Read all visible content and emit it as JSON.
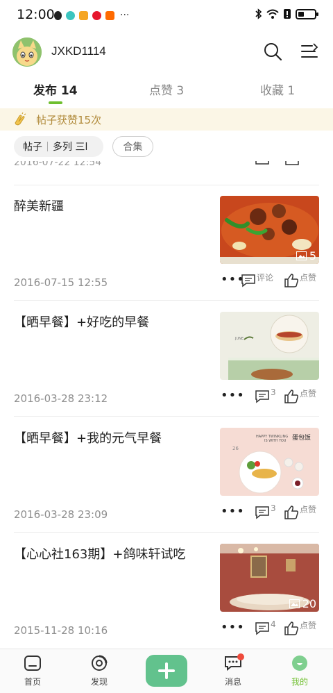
{
  "status_bar": {
    "time": "12:00",
    "more": "···"
  },
  "header": {
    "username": "JXKD1114"
  },
  "tabs": [
    {
      "label": "发布 14"
    },
    {
      "label": "点赞 3"
    },
    {
      "label": "收藏 1"
    }
  ],
  "likes_banner": {
    "text": "帖子获赞15次"
  },
  "filters": {
    "posts_label": "帖子",
    "series_label": "多列 三l",
    "collection_label": "合集"
  },
  "partial_post": {
    "date": "2016-07-22 12:54"
  },
  "posts": [
    {
      "title": "醉美新疆",
      "date": "2016-07-15 12:55",
      "image_count": "5",
      "comment_label": "评论",
      "like_label": "点赞",
      "comment_count": ""
    },
    {
      "title": "【晒早餐】+好吃的早餐",
      "date": "2016-03-28 23:12",
      "image_count": "",
      "comment_label": "",
      "like_label": "点赞",
      "comment_count": "3"
    },
    {
      "title": "【晒早餐】+我的元气早餐",
      "date": "2016-03-28 23:09",
      "image_count": "",
      "comment_label": "",
      "like_label": "点赞",
      "comment_count": "3"
    },
    {
      "title": "【心心社163期】+鸽味轩试吃",
      "date": "2015-11-28 10:16",
      "image_count": "20",
      "comment_label": "",
      "like_label": "点赞",
      "comment_count": "4"
    }
  ],
  "thumb_texts": {
    "b1": "JUNE",
    "b2_line1": "HAPPY TWINKLING",
    "b2_line2": "IS WITH YOU",
    "b2_brand": "蛋包饭",
    "b2_num": "26"
  },
  "bottom_nav": [
    {
      "label": "首页"
    },
    {
      "label": "发现"
    },
    {
      "label": ""
    },
    {
      "label": "消息"
    },
    {
      "label": "我的"
    }
  ],
  "colors": {
    "accent": "#6fbf2f",
    "fab": "#62c28d",
    "banner_bg": "#fbf6e6",
    "banner_text": "#b08a3a"
  }
}
